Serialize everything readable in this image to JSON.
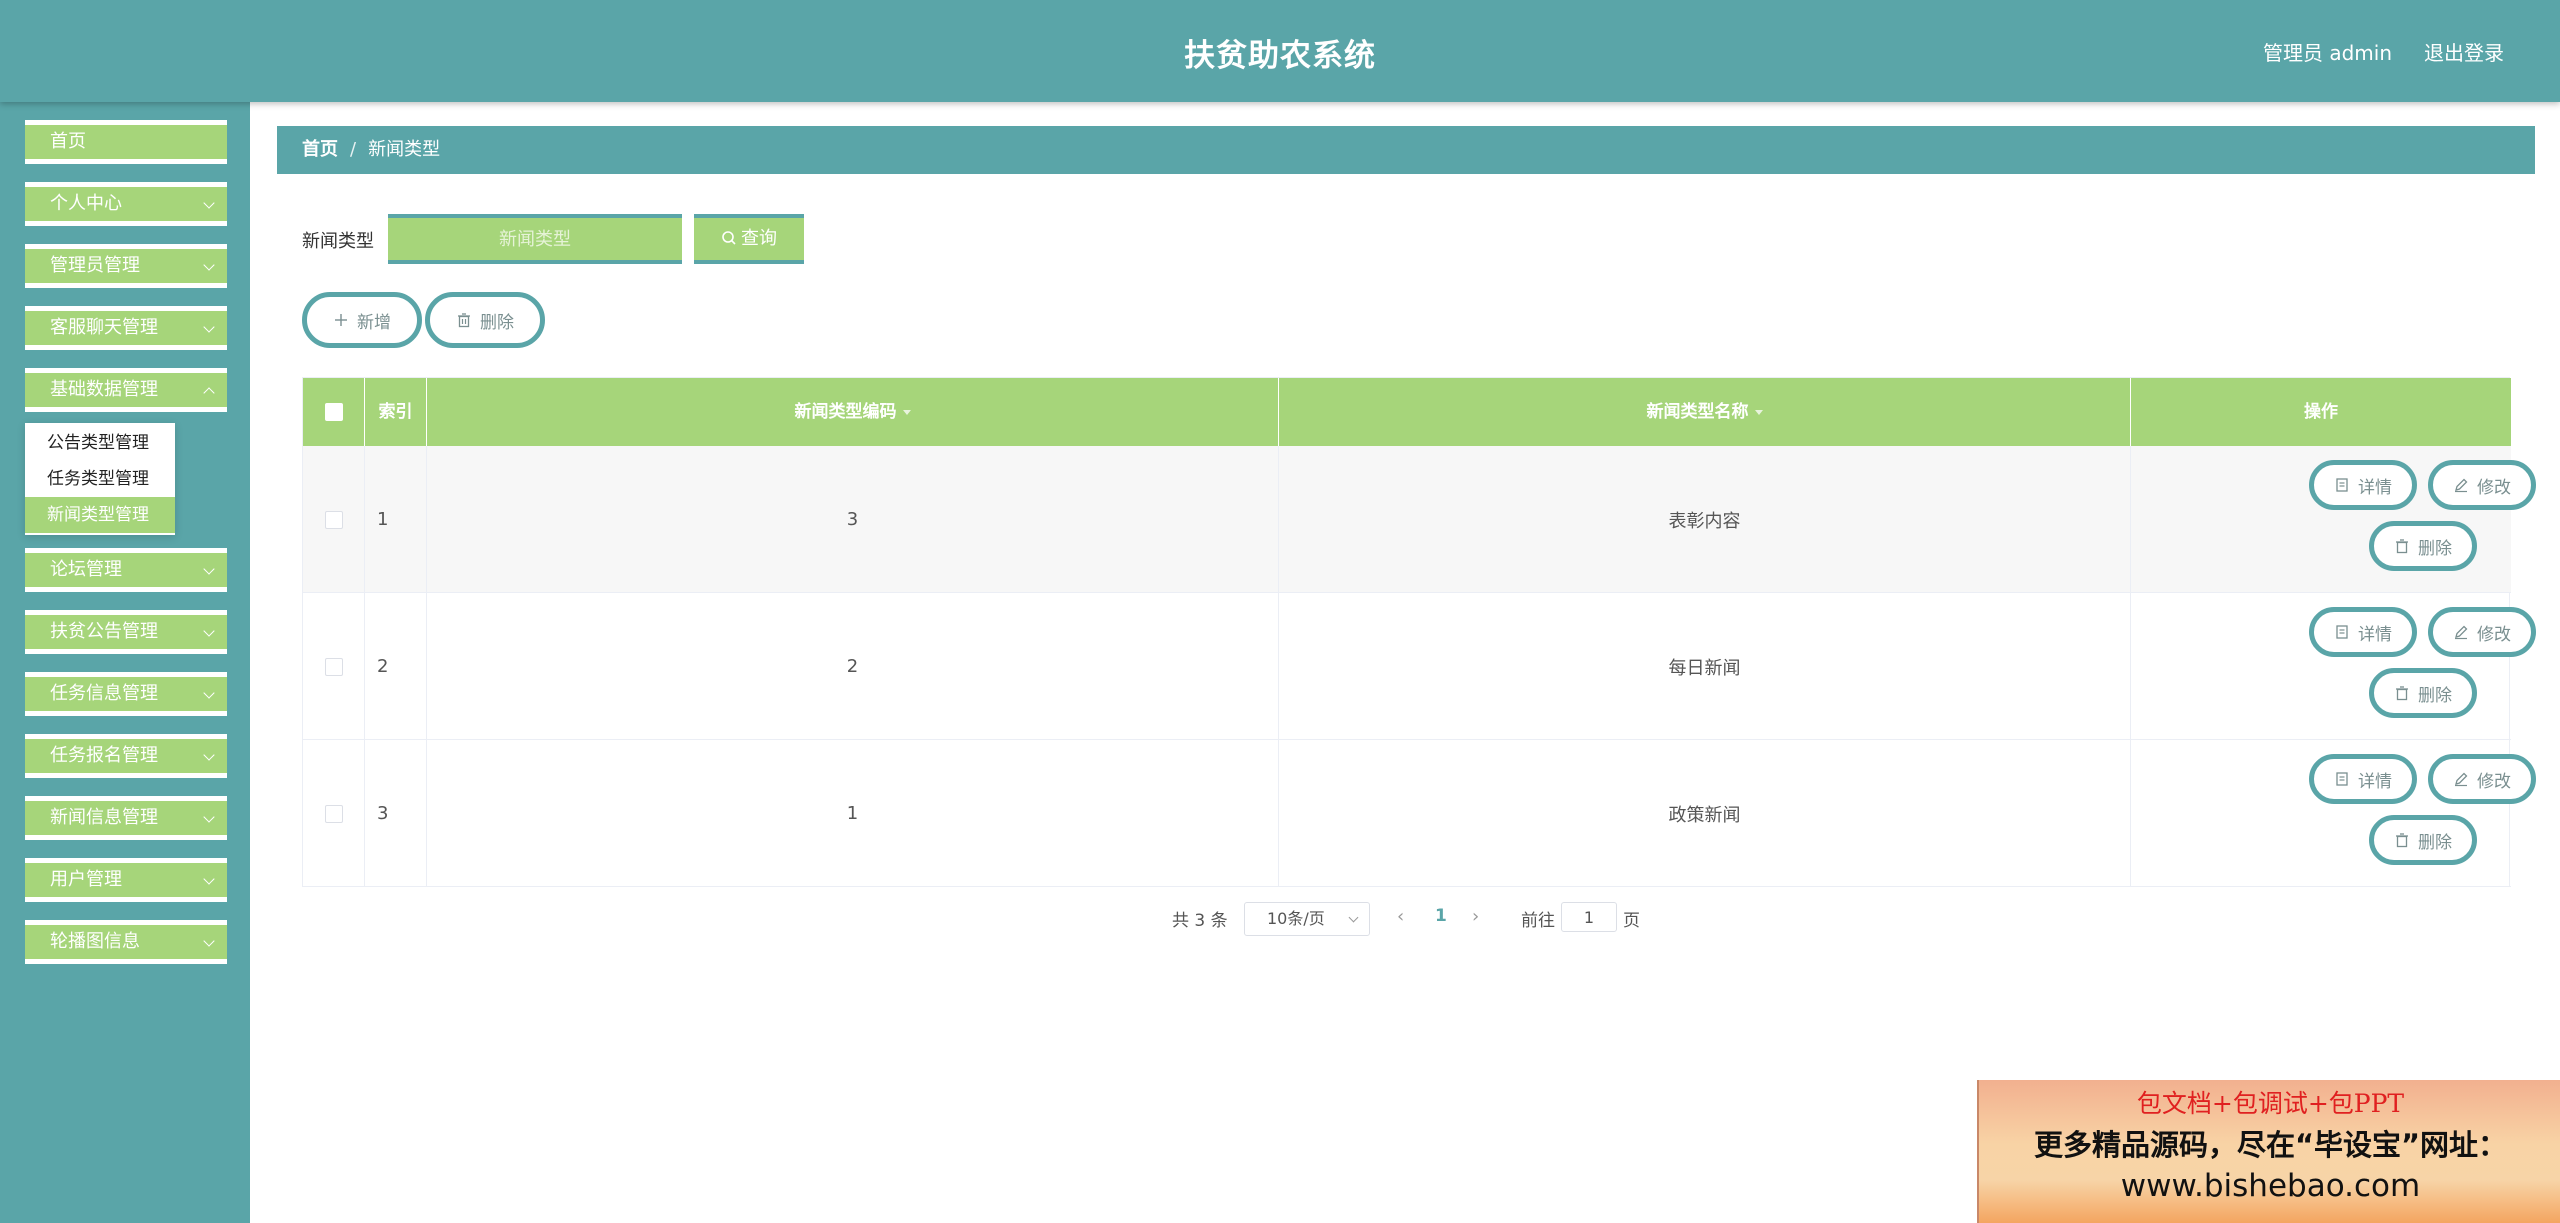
{
  "app": {
    "title": "扶贫助农系统",
    "user": "管理员 admin",
    "logout": "退出登录"
  },
  "sidebar": {
    "items": [
      {
        "label": "首页"
      },
      {
        "label": "个人中心"
      },
      {
        "label": "管理员管理"
      },
      {
        "label": "客服聊天管理"
      },
      {
        "label": "基础数据管理"
      },
      {
        "label": "论坛管理"
      },
      {
        "label": "扶贫公告管理"
      },
      {
        "label": "任务信息管理"
      },
      {
        "label": "任务报名管理"
      },
      {
        "label": "新闻信息管理"
      },
      {
        "label": "用户管理"
      },
      {
        "label": "轮播图信息"
      }
    ],
    "submenu": [
      {
        "label": "公告类型管理"
      },
      {
        "label": "任务类型管理"
      },
      {
        "label": "新闻类型管理"
      }
    ]
  },
  "breadcrumb": {
    "home": "首页",
    "separator": "/",
    "current": "新闻类型"
  },
  "search": {
    "label": "新闻类型",
    "placeholder": "新闻类型",
    "button": "查询"
  },
  "actions": {
    "add": "新增",
    "delete": "删除"
  },
  "table": {
    "headers": {
      "index": "索引",
      "code": "新闻类型编码",
      "name": "新闻类型名称",
      "ops": "操作"
    },
    "rows": [
      {
        "index": "1",
        "code": "3",
        "name": "表彰内容"
      },
      {
        "index": "2",
        "code": "2",
        "name": "每日新闻"
      },
      {
        "index": "3",
        "code": "1",
        "name": "政策新闻"
      }
    ],
    "row_actions": {
      "detail": "详情",
      "edit": "修改",
      "delete": "删除"
    }
  },
  "pagination": {
    "total": "共 3 条",
    "page_size": "10条/页",
    "current": "1",
    "goto": "前往",
    "goto_value": "1",
    "unit": "页"
  },
  "banner": {
    "line1": "包文档+包调试+包PPT",
    "line2": "更多精品源码，尽在“毕设宝”网址：",
    "line3": "www.bishebao.com"
  },
  "colors": {
    "teal": "#5aa5a8",
    "green": "#a6d57a"
  }
}
